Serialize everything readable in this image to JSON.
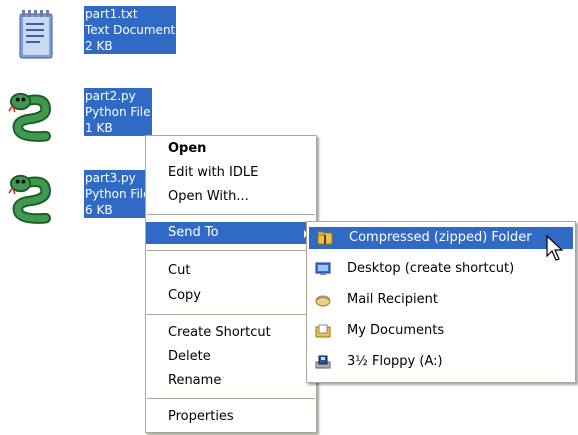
{
  "files": [
    {
      "name": "part1.txt",
      "type": "Text Document",
      "size": "2 KB",
      "icon": "notepad-icon"
    },
    {
      "name": "part2.py",
      "type": "Python File",
      "size": "1 KB",
      "icon": "python-snake-icon"
    },
    {
      "name": "part3.py",
      "type": "Python File",
      "size": "6 KB",
      "icon": "python-snake-icon"
    }
  ],
  "context_menu": {
    "items": [
      "Open",
      "Edit with IDLE",
      "Open With...",
      "Send To",
      "Cut",
      "Copy",
      "Create Shortcut",
      "Delete",
      "Rename",
      "Properties"
    ]
  },
  "send_to_menu": {
    "items": [
      {
        "label": "Compressed (zipped) Folder",
        "icon": "zip-folder-icon"
      },
      {
        "label": "Desktop (create shortcut)",
        "icon": "desktop-icon"
      },
      {
        "label": "Mail Recipient",
        "icon": "mail-icon"
      },
      {
        "label": "My Documents",
        "icon": "my-documents-icon"
      },
      {
        "label": "3½ Floppy (A:)",
        "icon": "floppy-drive-icon"
      }
    ]
  },
  "colors": {
    "selection": "#316ac5",
    "menu_border": "#aca899"
  }
}
